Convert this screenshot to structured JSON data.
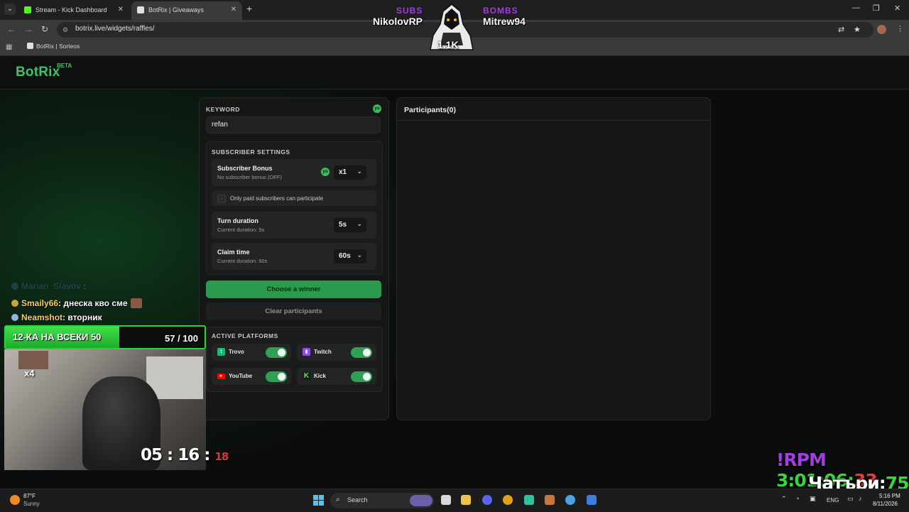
{
  "browser": {
    "tabs": [
      {
        "title": "Stream - Kick Dashboard",
        "active": false
      },
      {
        "title": "BotRix | Giveaways",
        "active": true
      }
    ],
    "url": "botrix.live/widgets/raffles/",
    "bookmark": "BotRix | Sorteos"
  },
  "site": {
    "logo": "BotRix",
    "beta": "BETA"
  },
  "raffle": {
    "keyword_label": "KEYWORD",
    "yo_badge": "yo",
    "keyword_value": "refan",
    "subscriber_settings_label": "SUBSCRIBER SETTINGS",
    "subscriber_bonus": {
      "title": "Subscriber Bonus",
      "subtitle": "No subscriber bonus (OFF)",
      "value": "x1"
    },
    "paid_only_label": "Only paid subscribers can participate",
    "turn_duration": {
      "title": "Turn duration",
      "subtitle": "Current duration: 5s",
      "value": "5s"
    },
    "claim_time": {
      "title": "Claim time",
      "subtitle": "Current duration: 60s",
      "value": "60s"
    },
    "choose_winner": "Choose a winner",
    "clear_participants": "Clear participants",
    "active_platforms_label": "ACTIVE PLATFORMS",
    "platforms": [
      {
        "name": "Trovo",
        "enabled": true,
        "color": "#1cb870"
      },
      {
        "name": "Twitch",
        "enabled": true,
        "color": "#9146ff"
      },
      {
        "name": "YouTube",
        "enabled": true,
        "color": "#ff0000"
      },
      {
        "name": "Kick",
        "enabled": true,
        "color": "#53fc18"
      }
    ],
    "participants_title": "Participants(0)"
  },
  "overlay": {
    "subs_label": "SUBS",
    "subs_name": "NikolovRP",
    "bombs_label": "BOMBS",
    "bombs_name": "Mitrew94",
    "mascot_count": "1.1K",
    "chat": [
      {
        "user": "Marian_Slavov",
        "message": ""
      },
      {
        "user": "Smaily66",
        "message": ": днеска кво сме"
      },
      {
        "user": "Neamshot",
        "message": ": вторник"
      }
    ],
    "goal": {
      "title": "12-КА НА ВСЕКИ 50",
      "count": "57 / 100",
      "progress": 0.57
    },
    "multiplier": "x4",
    "timer": {
      "main": "05 : 16 :",
      "seconds": "18"
    },
    "rpm": {
      "label": "!RPM",
      "time": "3:01:06:",
      "seconds": "33"
    },
    "chatters": {
      "label": "Чатъри:",
      "count": "75"
    }
  },
  "taskbar": {
    "temperature": "87°F",
    "weather": "Sunny",
    "search_label": "Search",
    "language": "ENG",
    "time": "5:16 PM",
    "date": "8/11/2026"
  },
  "colors": {
    "accent_green": "#2a9a4c",
    "logo_green": "#38c66b",
    "overlay_purple": "#a23de0"
  }
}
